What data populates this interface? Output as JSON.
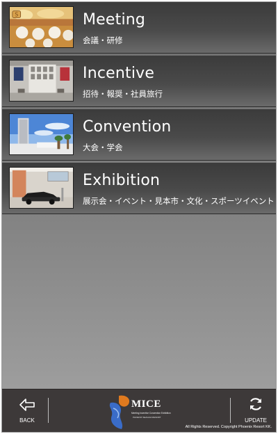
{
  "menu": [
    {
      "title": "Meeting",
      "subtitle": "会議・研修",
      "image": "banquet-hall-photo"
    },
    {
      "title": "Incentive",
      "subtitle": "招待・報奨・社員旅行",
      "image": "hotel-lobby-photo"
    },
    {
      "title": "Convention",
      "subtitle": "大会・学会",
      "image": "resort-tower-photo"
    },
    {
      "title": "Exhibition",
      "subtitle": "展示会・イベント・見本市・文化・スポーツイベント",
      "image": "car-showroom-photo"
    }
  ],
  "footer": {
    "back_label": "BACK",
    "update_label": "UPDATE",
    "logo_text": "MICE",
    "logo_tagline": "Meeting Incentive Convention Exhibition",
    "logo_tagline2": "PHOENIX SEAGAIA RESORT",
    "copyright": "All Rights Reserved. Copyright Phoenix Resort KK."
  },
  "colors": {
    "accent_orange": "#e07a1f",
    "logo_blue": "#3a6cc8",
    "footer_bg": "#3d3939"
  }
}
